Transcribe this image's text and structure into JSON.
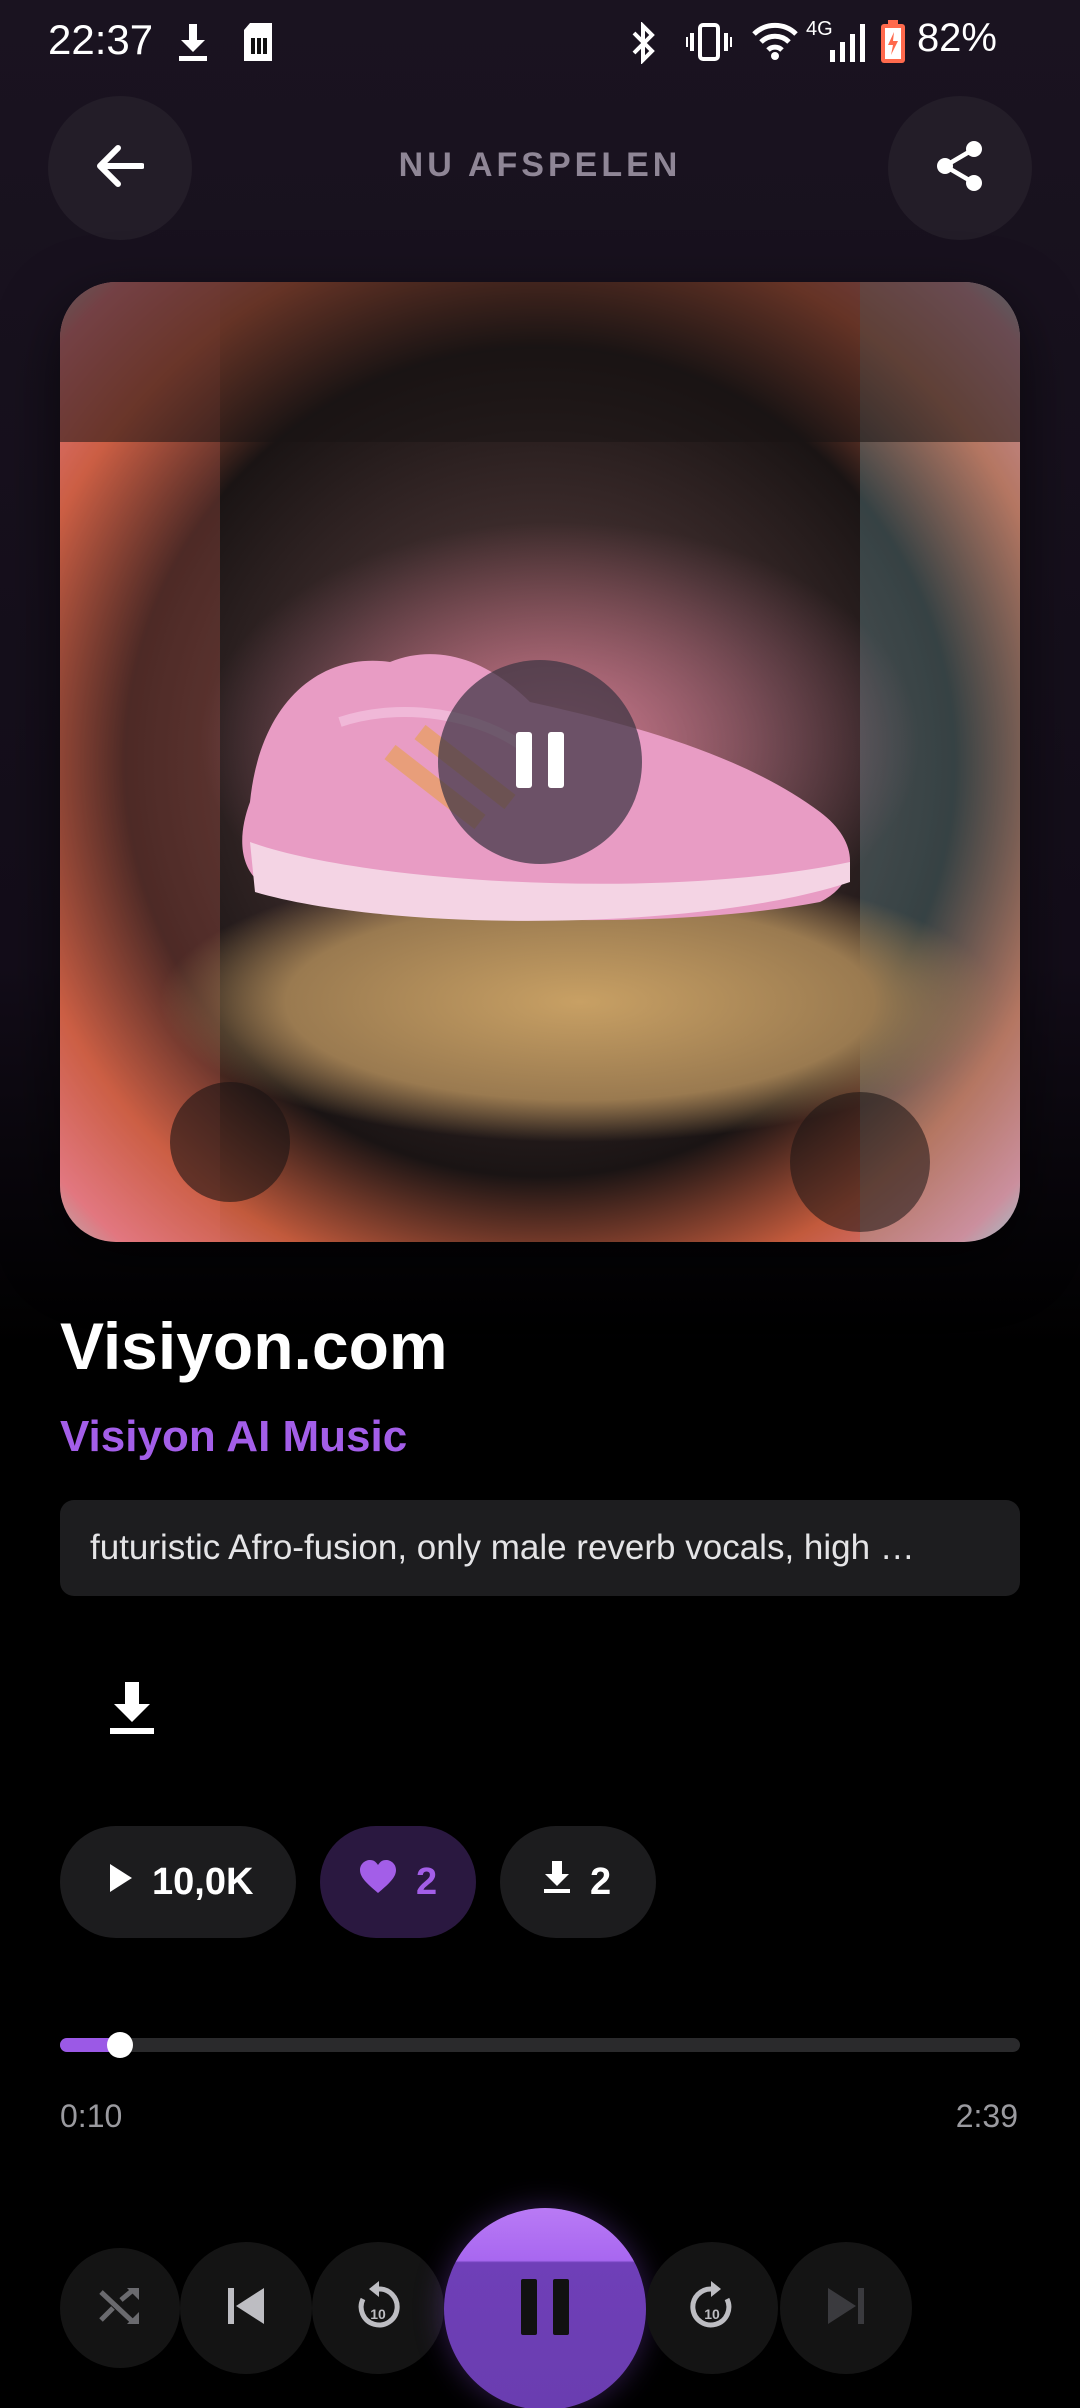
{
  "status_bar": {
    "time": "22:37",
    "network": "4G",
    "battery": "82%",
    "icons": [
      "download-icon",
      "sim-icon",
      "bluetooth-icon",
      "vibrate-icon",
      "wifi-icon",
      "signal-icon",
      "battery-icon"
    ]
  },
  "header": {
    "title": "NU AFSPELEN",
    "back_icon": "arrow-left-icon",
    "share_icon": "share-icon"
  },
  "artwork": {
    "overlay_icon": "pause-icon"
  },
  "song": {
    "title": "Visiyon.com",
    "artist": "Visiyon AI Music",
    "prompt": "futuristic Afro-fusion, only male reverb vocals, high …"
  },
  "stats": {
    "plays": "10,0K",
    "likes": "2",
    "downloads": "2"
  },
  "progress": {
    "current": "0:10",
    "total": "2:39",
    "fraction": 0.063
  },
  "controls": {
    "icons": [
      "shuffle-icon",
      "skip-previous-icon",
      "replay-10-icon",
      "pause-icon",
      "forward-10-icon",
      "skip-next-icon"
    ]
  },
  "colors": {
    "accent": "#a35ee8",
    "background": "#000000",
    "chip": "#1c1c1e",
    "liked_chip": "#2a1840"
  }
}
